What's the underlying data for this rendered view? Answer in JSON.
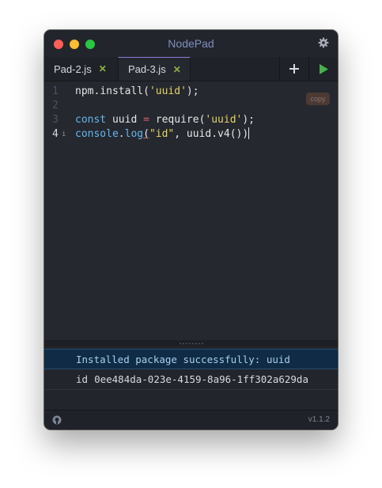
{
  "app": {
    "title": "NodePad",
    "version": "v1.1.2"
  },
  "tabs": [
    {
      "label": "Pad-2.js",
      "close": "✕",
      "active": false
    },
    {
      "label": "Pad-3.js",
      "close": "✕",
      "active": true
    }
  ],
  "toolbar": {
    "add_icon": "plus-icon",
    "run_icon": "play-icon",
    "settings_icon": "gear-icon"
  },
  "editor": {
    "copy_label": "copy",
    "line_numbers": [
      "1",
      "2",
      "3",
      "4"
    ],
    "line4_marker": "i",
    "line1": {
      "obj": "npm",
      "dot": ".",
      "fn": "install",
      "open": "(",
      "str": "'uuid'",
      "close": ");"
    },
    "line3": {
      "kw": "const",
      "var": " uuid ",
      "eq": "=",
      "fn": " require",
      "open": "(",
      "str": "'uuid'",
      "close": ");"
    },
    "line4": {
      "obj": "console",
      "dot": ".",
      "fn": "log",
      "open": "(",
      "str": "\"id\"",
      "comma": ", ",
      "arg": "uuid.v4()",
      "close": ")"
    }
  },
  "console": {
    "success_message": "Installed package successfully: uuid",
    "output": {
      "key": "id",
      "value": "0ee484da-023e-4159-8a96-1ff302a629da"
    }
  },
  "colors": {
    "background": "#25282f",
    "keyword": "#65b6f1",
    "string": "#e5d464",
    "operator": "#e0626c",
    "run_green": "#47b04b",
    "tab_close_green": "#8cb240",
    "success_bg": "#0f2b45"
  }
}
